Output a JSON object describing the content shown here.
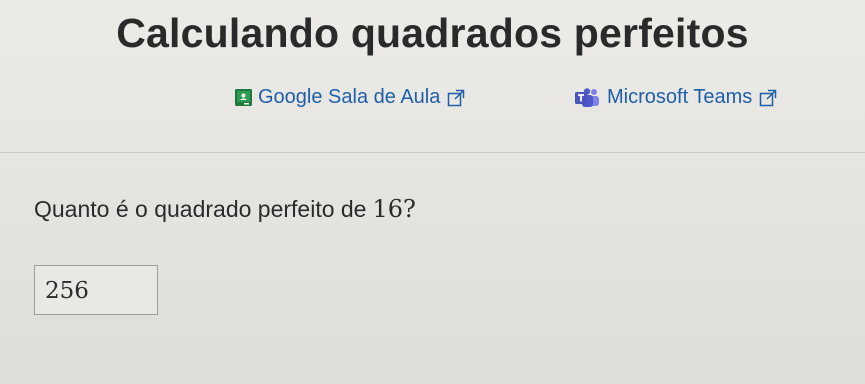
{
  "title": "Calculando quadrados perfeitos",
  "share": {
    "classroom": {
      "label": "Google Sala de Aula",
      "icon": "google-classroom-icon",
      "external_icon": "external-link-icon"
    },
    "teams": {
      "label": "Microsoft Teams",
      "icon": "microsoft-teams-icon",
      "external_icon": "external-link-icon"
    }
  },
  "question": {
    "prefix": "Quanto é o quadrado perfeito de",
    "number": "16",
    "suffix": "?"
  },
  "answer": {
    "value": "256"
  },
  "colors": {
    "link": "#1f5fa8",
    "classroom_icon": "#1e7a3c",
    "teams_icon": "#4b53bc",
    "text": "#2b2b2b"
  }
}
